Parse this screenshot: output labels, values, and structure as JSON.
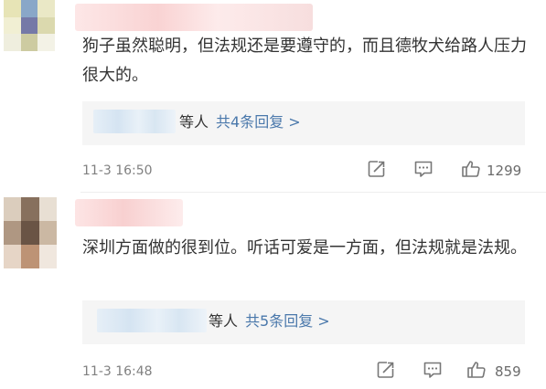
{
  "comments": [
    {
      "text": "狗子虽然聪明，但法规还是要遵守的，而且德牧犬给路人压力很大的。",
      "replies": {
        "who": "等人",
        "link": "共4条回复 >"
      },
      "time": "11-3 16:50",
      "likes": "1299",
      "icons": [
        "forward-icon",
        "comment-icon",
        "thumbs-up-icon"
      ]
    },
    {
      "text": "深圳方面做的很到位。听话可爱是一方面，但法规就是法规。",
      "replies": {
        "who": "等人",
        "link": "共5条回复 >"
      },
      "time": "11-3 16:48",
      "likes": "859",
      "icons": [
        "forward-icon",
        "comment-icon",
        "thumbs-up-icon"
      ]
    }
  ],
  "colors": {
    "link": "#4a78ab",
    "time": "#808080",
    "reply_bg": "#f5f5f5",
    "text": "#333333"
  }
}
